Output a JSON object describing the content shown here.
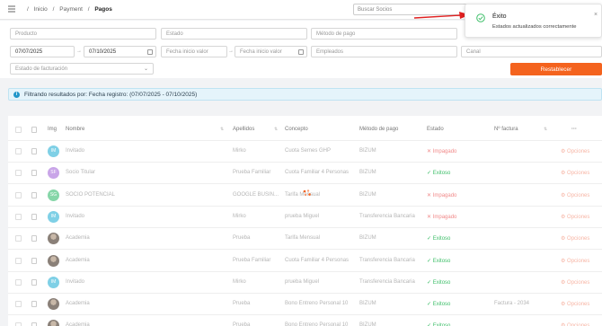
{
  "breadcrumb": {
    "sep": "/",
    "items": [
      "Inicio",
      "Payment",
      "Pagos"
    ]
  },
  "search": {
    "placeholder": "Buscar Socios"
  },
  "filters": {
    "producto": "Producto",
    "estado": "Estado",
    "metodo_pago": "Método de pago",
    "fecha_desde": "07/07/2025",
    "fecha_hasta": "07/10/2025",
    "fecha_inicio_valor": "Fecha inicio valor",
    "fecha_fin_valor": "Fecha inicio valor",
    "empleados": "Empleados",
    "canal": "Canal",
    "estado_facturacion": "Estado de facturación",
    "reset_label": "Restablecer"
  },
  "info_banner": {
    "prefix": "Filtrando resultados por:",
    "text": "Fecha registro: (07/07/2025 - 07/10/2025)"
  },
  "table": {
    "columns": {
      "img": "Img",
      "nombre": "Nombre",
      "apellidos": "Apellidos",
      "concepto": "Concepto",
      "metodo": "Método de pago",
      "estado": "Estado",
      "factura": "Nº factura",
      "more": "···"
    },
    "rows": [
      {
        "initials": "IM",
        "nombre": "Invitado",
        "apellidos": "Mirko",
        "concepto": "Cuota Semes GHP",
        "metodo": "BIZUM",
        "estado": "Impagado",
        "factura": "",
        "opciones": "Opciones"
      },
      {
        "initials": "SF",
        "nombre": "Socio Titular",
        "apellidos": "Prueba Familiar",
        "concepto": "Cuota Familiar 4 Personas",
        "metodo": "BIZUM",
        "estado": "Exitoso",
        "factura": "",
        "opciones": "Opciones"
      },
      {
        "initials": "SG",
        "nombre": "SOCIO POTENCIAL",
        "apellidos": "GOOGLE BUSIN...",
        "concepto": "Tarifa Mensual",
        "metodo": "BIZUM",
        "estado": "Impagado",
        "factura": "",
        "opciones": "Opciones"
      },
      {
        "initials": "IM",
        "nombre": "Invitado",
        "apellidos": "Mirko",
        "concepto": "prueba Miguel",
        "metodo": "Transferencia Bancaria",
        "estado": "Impagado",
        "factura": "",
        "opciones": "Opciones"
      },
      {
        "initials": "",
        "nombre": "Academia",
        "apellidos": "Prueba",
        "concepto": "Tarifa Mensual",
        "metodo": "BIZUM",
        "estado": "Exitoso",
        "factura": "",
        "opciones": "Opciones"
      },
      {
        "initials": "",
        "nombre": "Academia",
        "apellidos": "Prueba Familiar",
        "concepto": "Cuota Familiar 4 Personas",
        "metodo": "Transferencia Bancaria",
        "estado": "Exitoso",
        "factura": "",
        "opciones": "Opciones"
      },
      {
        "initials": "IM",
        "nombre": "Invitado",
        "apellidos": "Mirko",
        "concepto": "prueba Miguel",
        "metodo": "Transferencia Bancaria",
        "estado": "Exitoso",
        "factura": "",
        "opciones": "Opciones"
      },
      {
        "initials": "",
        "nombre": "Academia",
        "apellidos": "Prueba",
        "concepto": "Bono Entreno Personal 10",
        "metodo": "BIZUM",
        "estado": "Exitoso",
        "factura": "Factura - 2034",
        "opciones": "Opciones"
      },
      {
        "initials": "",
        "nombre": "Academia",
        "apellidos": "Prueba",
        "concepto": "Bono Entreno Personal 10",
        "metodo": "BIZUM",
        "estado": "Exitoso",
        "factura": "",
        "opciones": "Opciones"
      }
    ]
  },
  "toast": {
    "title": "Éxito",
    "message": "Estados actualizados correctamente"
  },
  "colors": {
    "accent": "#f4631e",
    "success": "#3fbf6a",
    "danger": "#f18a8a",
    "info_bg": "#e5f4fb",
    "arrow": "#e02020"
  },
  "icons": [
    "menu-icon",
    "calendar-icon",
    "chevron-down-icon",
    "info-icon",
    "success-check-icon",
    "close-icon",
    "spinner-icon"
  ]
}
